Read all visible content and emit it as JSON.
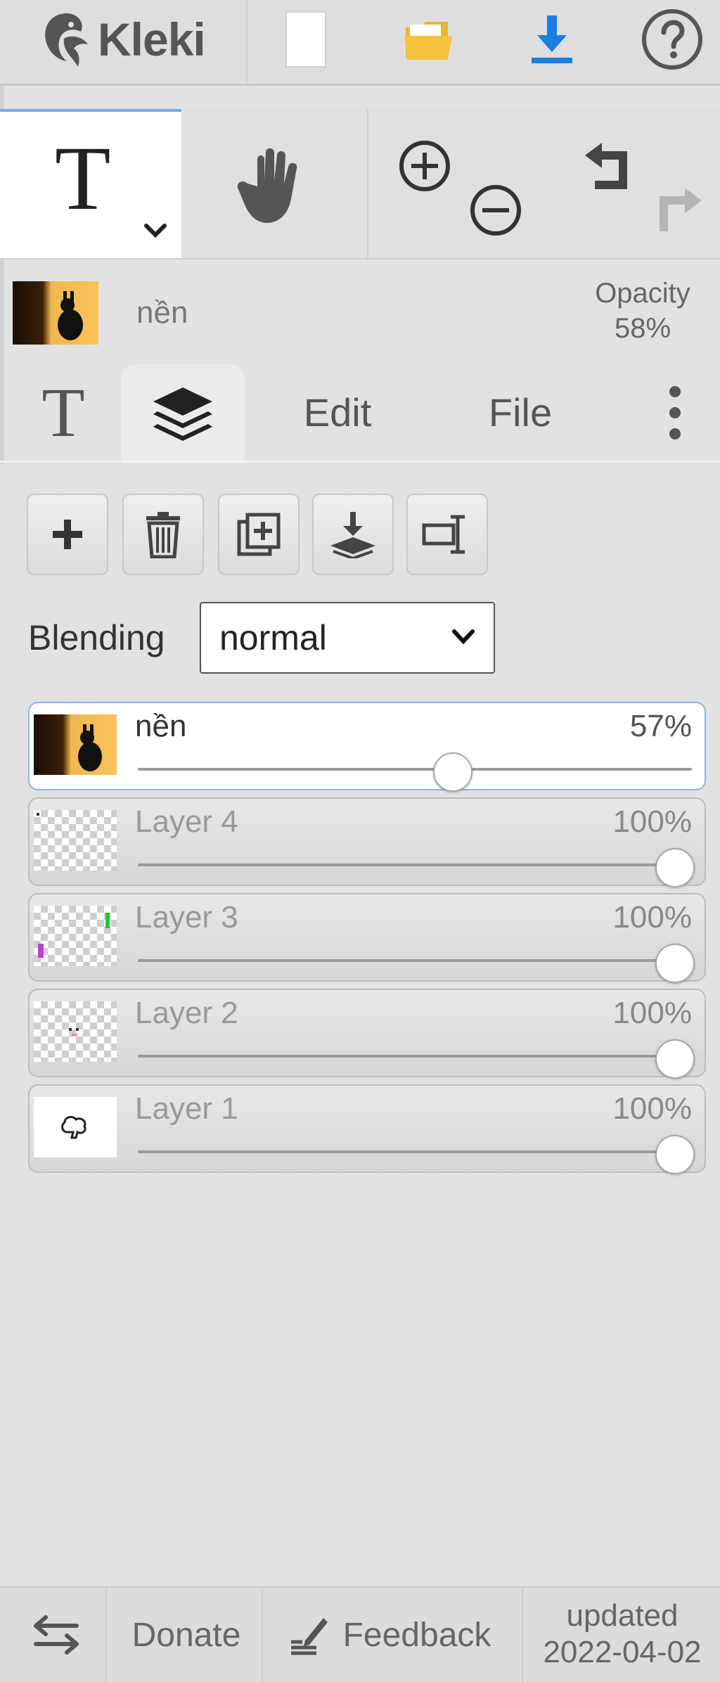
{
  "app": {
    "name": "Kleki"
  },
  "topbar": {
    "buttons": [
      "new-image",
      "open-file",
      "save-download",
      "help"
    ]
  },
  "tools": {
    "active_tool": "text",
    "items": [
      "text-tool",
      "hand-tool",
      "zoom-in",
      "zoom-out",
      "undo",
      "redo"
    ]
  },
  "current_layer": {
    "name": "nền",
    "opacity_label": "Opacity",
    "opacity_value": "58%"
  },
  "tabs": {
    "items": [
      {
        "label": "T",
        "id": "text"
      },
      {
        "label": "",
        "id": "layers"
      },
      {
        "label": "Edit",
        "id": "edit"
      },
      {
        "label": "File",
        "id": "file"
      }
    ],
    "active": "layers"
  },
  "layer_actions": [
    "add-layer",
    "delete-layer",
    "duplicate-layer",
    "merge-down",
    "rename-layer"
  ],
  "blending": {
    "label": "Blending",
    "value": "normal"
  },
  "layers": [
    {
      "name": "nền",
      "opacity_text": "57%",
      "opacity": 0.57,
      "active": true
    },
    {
      "name": "Layer 4",
      "opacity_text": "100%",
      "opacity": 1.0,
      "active": false
    },
    {
      "name": "Layer 3",
      "opacity_text": "100%",
      "opacity": 1.0,
      "active": false
    },
    {
      "name": "Layer 2",
      "opacity_text": "100%",
      "opacity": 1.0,
      "active": false
    },
    {
      "name": "Layer 1",
      "opacity_text": "100%",
      "opacity": 1.0,
      "active": false
    }
  ],
  "footer": {
    "donate": "Donate",
    "feedback": "Feedback",
    "updated_label": "updated",
    "updated_date": "2022-04-02"
  },
  "colors": {
    "accent_blue": "#1a7fe0",
    "folder_yellow": "#f5c33b",
    "active_outline": "#8fb2e6"
  }
}
